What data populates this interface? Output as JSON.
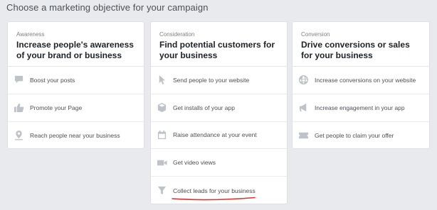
{
  "page": {
    "title": "Choose a marketing objective for your campaign"
  },
  "columns": [
    {
      "kicker": "Awareness",
      "title": "Increase people's awareness of your brand or business",
      "items": [
        {
          "label": "Boost your posts",
          "icon": "chat-bubble-icon"
        },
        {
          "label": "Promote your Page",
          "icon": "thumbs-up-icon"
        },
        {
          "label": "Reach people near your business",
          "icon": "location-pin-icon"
        }
      ]
    },
    {
      "kicker": "Consideration",
      "title": "Find potential customers for your business",
      "items": [
        {
          "label": "Send people to your website",
          "icon": "cursor-arrow-icon"
        },
        {
          "label": "Get installs of your app",
          "icon": "cube-icon"
        },
        {
          "label": "Raise attendance at your event",
          "icon": "calendar-icon"
        },
        {
          "label": "Get video views",
          "icon": "video-camera-icon"
        },
        {
          "label": "Collect leads for your business",
          "icon": "funnel-icon"
        }
      ]
    },
    {
      "kicker": "Conversion",
      "title": "Drive conversions or sales for your business",
      "items": [
        {
          "label": "Increase conversions on your website",
          "icon": "globe-icon"
        },
        {
          "label": "Increase engagement in your app",
          "icon": "megaphone-icon"
        },
        {
          "label": "Get people to claim your offer",
          "icon": "ticket-icon"
        }
      ]
    }
  ],
  "colors": {
    "annotation": "#e0312b",
    "icon": "#bec3c9"
  }
}
